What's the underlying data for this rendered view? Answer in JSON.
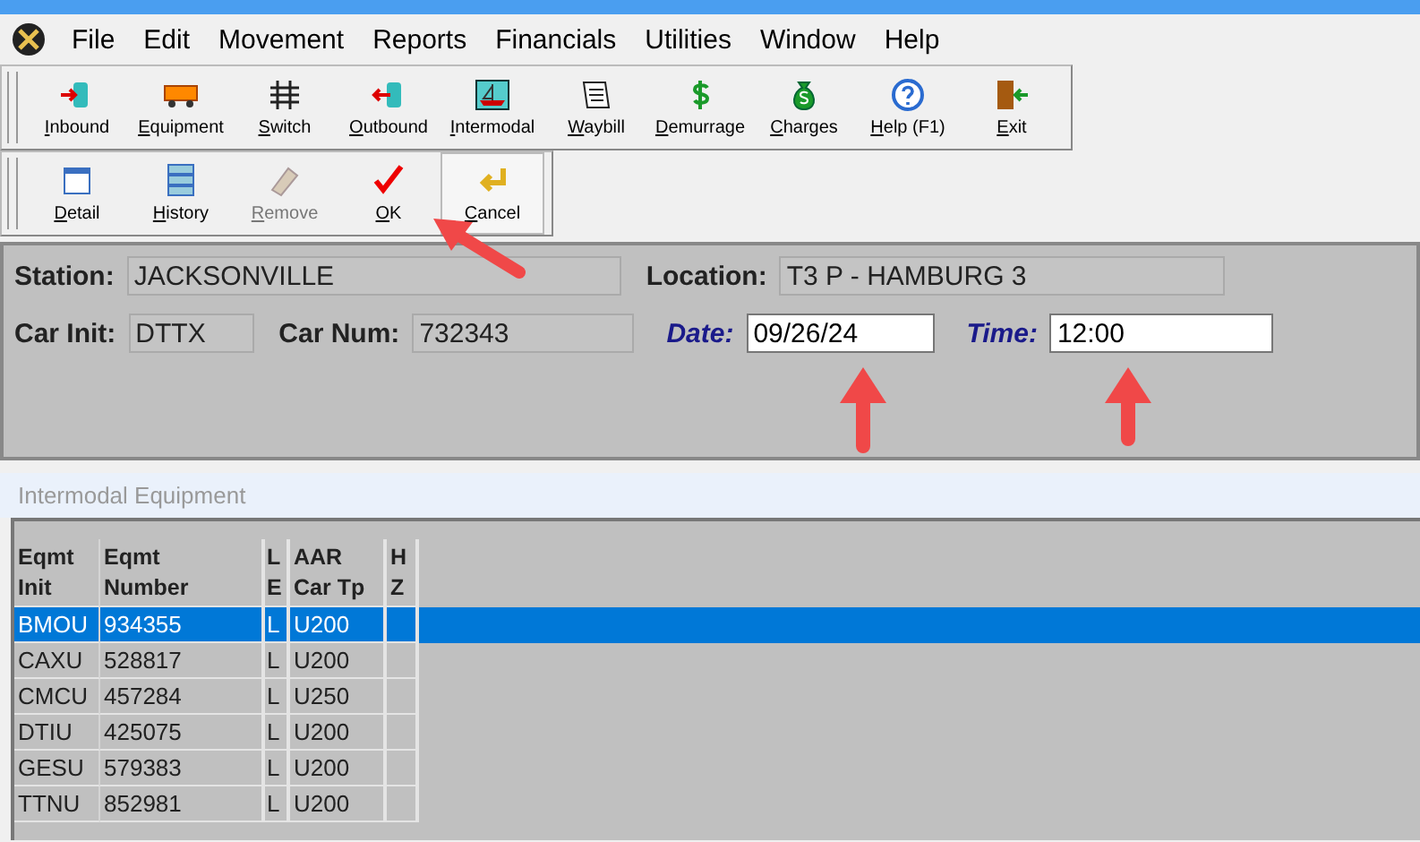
{
  "menu": [
    "File",
    "Edit",
    "Movement",
    "Reports",
    "Financials",
    "Utilities",
    "Window",
    "Help"
  ],
  "toolbar_main": [
    {
      "label": "Inbound",
      "kind": "inbound"
    },
    {
      "label": "Equipment",
      "kind": "equipment"
    },
    {
      "label": "Switch",
      "kind": "switch"
    },
    {
      "label": "Outbound",
      "kind": "outbound"
    },
    {
      "label": "Intermodal",
      "kind": "intermodal"
    },
    {
      "label": "Waybill",
      "kind": "waybill"
    },
    {
      "label": "Demurrage",
      "kind": "demurrage"
    },
    {
      "label": "Charges",
      "kind": "charges"
    },
    {
      "label": "Help (F1)",
      "kind": "help"
    },
    {
      "label": "Exit",
      "kind": "exit"
    }
  ],
  "toolbar_edit": [
    {
      "label": "Detail",
      "kind": "detail",
      "disabled": false
    },
    {
      "label": "History",
      "kind": "history",
      "disabled": false
    },
    {
      "label": "Remove",
      "kind": "remove",
      "disabled": true
    },
    {
      "label": "OK",
      "kind": "ok",
      "disabled": false
    },
    {
      "label": "Cancel",
      "kind": "cancel",
      "disabled": false
    }
  ],
  "form": [
    [
      {
        "label": "Station:",
        "value": "JACKSONVILLE",
        "editable": false
      },
      {
        "label": "Location:",
        "value": "T3 P - HAMBURG 3",
        "editable": false
      }
    ],
    [
      {
        "label": "Car Init:",
        "value": "DTTX",
        "editable": false
      },
      {
        "label": "Car Num:",
        "value": "732343",
        "editable": false
      },
      {
        "label": "Date:",
        "value": "09/26/24",
        "editable": true
      },
      {
        "label": "Time:",
        "value": "12:00",
        "editable": true
      }
    ]
  ],
  "panel_title": "Intermodal Equipment",
  "table": {
    "columns": [
      "Eqmt\nInit",
      "Eqmt\nNumber",
      "L\nE",
      "AAR\nCar Tp",
      "H\nZ"
    ],
    "rows": [
      {
        "cells": [
          "BMOU",
          "934355",
          "L",
          "U200",
          ""
        ],
        "selected": true
      },
      {
        "cells": [
          "CAXU",
          "528817",
          "L",
          "U200",
          ""
        ],
        "selected": false
      },
      {
        "cells": [
          "CMCU",
          "457284",
          "L",
          "U250",
          ""
        ],
        "selected": false
      },
      {
        "cells": [
          "DTIU",
          "425075",
          "L",
          "U200",
          ""
        ],
        "selected": false
      },
      {
        "cells": [
          "GESU",
          "579383",
          "L",
          "U200",
          ""
        ],
        "selected": false
      },
      {
        "cells": [
          "TTNU",
          "852981",
          "L",
          "U200",
          ""
        ],
        "selected": false
      }
    ]
  }
}
